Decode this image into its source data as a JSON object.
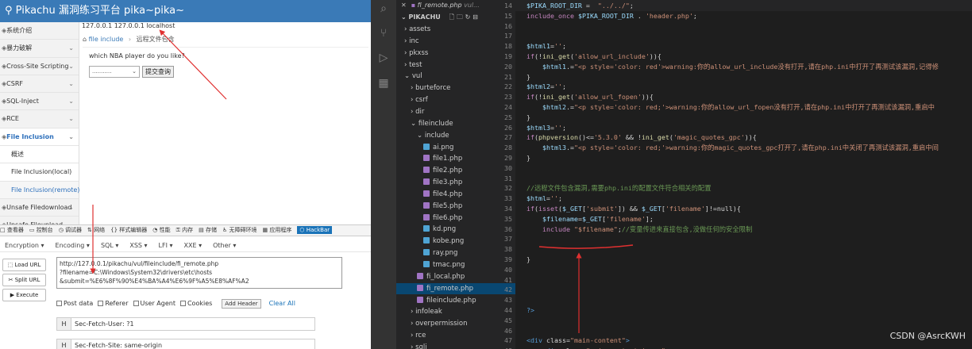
{
  "browser": {
    "app_title": "Pikachu 漏洞练习平台 pika~pika~",
    "address_text": "127.0.0.1 127.0.0.1 localhost",
    "breadcrumb": {
      "parent": "file include",
      "current": "远程文件包含"
    },
    "page": {
      "question": "which NBA player do you like?",
      "select_value": "...........",
      "submit_label": "提交查询"
    },
    "sidebar": [
      {
        "label": "系统介绍",
        "chevron": ""
      },
      {
        "label": "暴力破解",
        "chevron": "⌄"
      },
      {
        "label": "Cross-Site Scripting",
        "chevron": "⌄"
      },
      {
        "label": "CSRF",
        "chevron": "⌄"
      },
      {
        "label": "SQL-Inject",
        "chevron": "⌄"
      },
      {
        "label": "RCE",
        "chevron": "⌄"
      },
      {
        "label": "File Inclusion",
        "chevron": "⌄"
      },
      {
        "label": "概述",
        "chevron": ""
      },
      {
        "label": "File Inclusion(local)",
        "chevron": ""
      },
      {
        "label": "File Inclusion(remote)",
        "chevron": ""
      },
      {
        "label": "Unsafe Filedownload",
        "chevron": "⌄"
      },
      {
        "label": "Unsafe Fileupload",
        "chevron": "⌄"
      }
    ],
    "devtools_tabs": [
      "查看器",
      "控制台",
      "调试器",
      "网络",
      "样式编辑器",
      "性能",
      "内存",
      "存储",
      "无障碍环境",
      "应用程序",
      "HackBar"
    ],
    "hackbar": {
      "menu": [
        "Encryption ▾",
        "Encoding ▾",
        "SQL ▾",
        "XSS ▾",
        "LFI ▾",
        "XXE ▾",
        "Other ▾"
      ],
      "load_url": "Load URL",
      "split_url": "Split URL",
      "execute": "Execute",
      "url_lines": [
        "http://127.0.0.1/pikachu/vul/fileinclude/fi_remote.php",
        "?filename=C:\\Windows\\System32\\drivers\\etc\\hosts",
        "&submit=%E6%8F%90%E4%BA%A4%E6%9F%A5%E8%AF%A2"
      ],
      "options": [
        "Post data",
        "Referer",
        "User Agent",
        "Cookies"
      ],
      "add_header": "Add Header",
      "clear_all": "Clear All",
      "headers": [
        {
          "key": "H",
          "value": "Sec-Fetch-User: ?1"
        },
        {
          "key": "H",
          "value": "Sec-Fetch-Site: same-origin"
        }
      ]
    }
  },
  "vscode": {
    "open_tab": {
      "name": "fi_remote.php",
      "path": "vul..."
    },
    "explorer_root": "PIKACHU",
    "tree": [
      {
        "label": "› assets",
        "type": "folder",
        "indent": 1
      },
      {
        "label": "› inc",
        "type": "folder",
        "indent": 1
      },
      {
        "label": "› pkxss",
        "type": "folder",
        "indent": 1
      },
      {
        "label": "› test",
        "type": "folder",
        "indent": 1
      },
      {
        "label": "⌄ vul",
        "type": "folder",
        "indent": 1
      },
      {
        "label": "› burteforce",
        "type": "folder",
        "indent": 2
      },
      {
        "label": "› csrf",
        "type": "folder",
        "indent": 2
      },
      {
        "label": "› dir",
        "type": "folder",
        "indent": 2
      },
      {
        "label": "⌄ fileinclude",
        "type": "folder",
        "indent": 2
      },
      {
        "label": "⌄ include",
        "type": "folder",
        "indent": 3
      },
      {
        "label": "ai.png",
        "type": "png",
        "indent": 4
      },
      {
        "label": "file1.php",
        "type": "php",
        "indent": 4
      },
      {
        "label": "file2.php",
        "type": "php",
        "indent": 4
      },
      {
        "label": "file3.php",
        "type": "php",
        "indent": 4
      },
      {
        "label": "file4.php",
        "type": "php",
        "indent": 4
      },
      {
        "label": "file5.php",
        "type": "php",
        "indent": 4
      },
      {
        "label": "file6.php",
        "type": "php",
        "indent": 4
      },
      {
        "label": "kd.png",
        "type": "png",
        "indent": 4
      },
      {
        "label": "kobe.png",
        "type": "png",
        "indent": 4
      },
      {
        "label": "ray.png",
        "type": "png",
        "indent": 4
      },
      {
        "label": "tmac.png",
        "type": "png",
        "indent": 4
      },
      {
        "label": "fi_local.php",
        "type": "php",
        "indent": 3
      },
      {
        "label": "fi_remote.php",
        "type": "php",
        "indent": 3,
        "selected": true
      },
      {
        "label": "fileinclude.php",
        "type": "php",
        "indent": 3
      },
      {
        "label": "› infoleak",
        "type": "folder",
        "indent": 2
      },
      {
        "label": "› overpermission",
        "type": "folder",
        "indent": 2
      },
      {
        "label": "› rce",
        "type": "folder",
        "indent": 2
      },
      {
        "label": "› sqli",
        "type": "folder",
        "indent": 2
      }
    ],
    "lines": [
      {
        "n": "14",
        "t": "$PIKA_ROOT_DIR =  \"../../\";"
      },
      {
        "n": "15",
        "t": "include_once $PIKA_ROOT_DIR . 'header.php';"
      },
      {
        "n": "16",
        "t": ""
      },
      {
        "n": "17",
        "t": ""
      },
      {
        "n": "18",
        "t": "$html1='';"
      },
      {
        "n": "19",
        "t": "if(!ini_get('allow_url_include')){"
      },
      {
        "n": "20",
        "t": "    $html1.=\"<p style='color: red'>warning:你的allow_url_include没有打开,请在php.ini中打开了再测试该漏洞,记得修"
      },
      {
        "n": "21",
        "t": "}"
      },
      {
        "n": "22",
        "t": "$html2='';"
      },
      {
        "n": "23",
        "t": "if(!ini_get('allow_url_fopen')){"
      },
      {
        "n": "24",
        "t": "    $html2.=\"<p style='color: red;'>warning:你的allow_url_fopen没有打开,请在php.ini中打开了再测试该漏洞,重启中"
      },
      {
        "n": "25",
        "t": "}"
      },
      {
        "n": "26",
        "t": "$html3='';"
      },
      {
        "n": "27",
        "t": "if(phpversion()<='5.3.0' && !ini_get('magic_quotes_gpc')){"
      },
      {
        "n": "28",
        "t": "    $html3.=\"<p style='color: red;'>warning:你的magic_quotes_gpc打开了,请在php.ini中关闭了再测试该漏洞,重启中间"
      },
      {
        "n": "29",
        "t": "}"
      },
      {
        "n": "30",
        "t": ""
      },
      {
        "n": "31",
        "t": ""
      },
      {
        "n": "32",
        "t": "//远程文件包含漏洞,需要php.ini的配置文件符合相关的配置"
      },
      {
        "n": "33",
        "t": "$html='';"
      },
      {
        "n": "34",
        "t": "if(isset($_GET['submit']) && $_GET['filename']!=null){"
      },
      {
        "n": "35",
        "t": "    $filename=$_GET['filename'];"
      },
      {
        "n": "36",
        "t": "    include \"$filename\";//变量传进来直接包含,没做任何的安全限制"
      },
      {
        "n": "37",
        "t": ""
      },
      {
        "n": "38",
        "t": ""
      },
      {
        "n": "39",
        "t": "}"
      },
      {
        "n": "40",
        "t": ""
      },
      {
        "n": "41",
        "t": ""
      },
      {
        "n": "42",
        "t": ""
      },
      {
        "n": "43",
        "t": ""
      },
      {
        "n": "44",
        "t": "?>"
      },
      {
        "n": "45",
        "t": ""
      },
      {
        "n": "46",
        "t": ""
      },
      {
        "n": "47",
        "t": "<div class=\"main-content\">"
      },
      {
        "n": "48",
        "t": "    <div class=\"main-content-inner\">"
      }
    ]
  },
  "watermark": "CSDN @AsrcKWH",
  "colors": {
    "annotation": "#e03030",
    "selection": "#094771",
    "topbar": "#3a7ab7"
  }
}
